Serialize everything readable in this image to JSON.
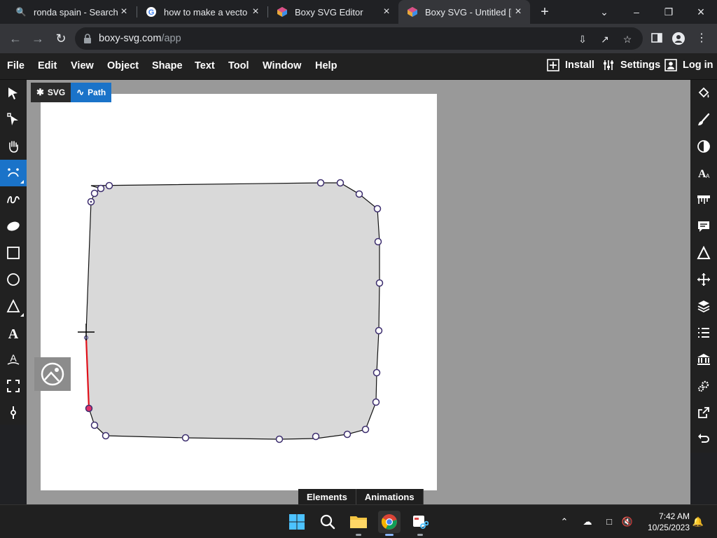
{
  "browser": {
    "tabs": [
      {
        "title": "ronda spain - Search",
        "active": false
      },
      {
        "title": "how to make a vector i",
        "active": false
      },
      {
        "title": "Boxy SVG Editor",
        "active": false
      },
      {
        "title": "Boxy SVG - Untitled [Ed",
        "active": true
      }
    ],
    "new_tab": "+",
    "url_host": "boxy-svg.com",
    "url_path": "/app"
  },
  "menubar": {
    "items": [
      "File",
      "Edit",
      "View",
      "Object",
      "Shape",
      "Text",
      "Tool",
      "Window",
      "Help"
    ],
    "install": "Install",
    "settings": "Settings",
    "login": "Log in"
  },
  "breadcrumb": {
    "svg": "SVG",
    "path": "Path"
  },
  "bottom_tabs": {
    "elements": "Elements",
    "animations": "Animations"
  },
  "taskbar": {
    "time": "7:42 AM",
    "date": "10/25/2023"
  },
  "colors": {
    "accent": "#1a73c9",
    "panel": "#212121",
    "workspace": "#999999",
    "shape_fill": "#d9d9d9",
    "node_stroke": "#3c2d6e",
    "selected_segment": "#e0101a"
  }
}
